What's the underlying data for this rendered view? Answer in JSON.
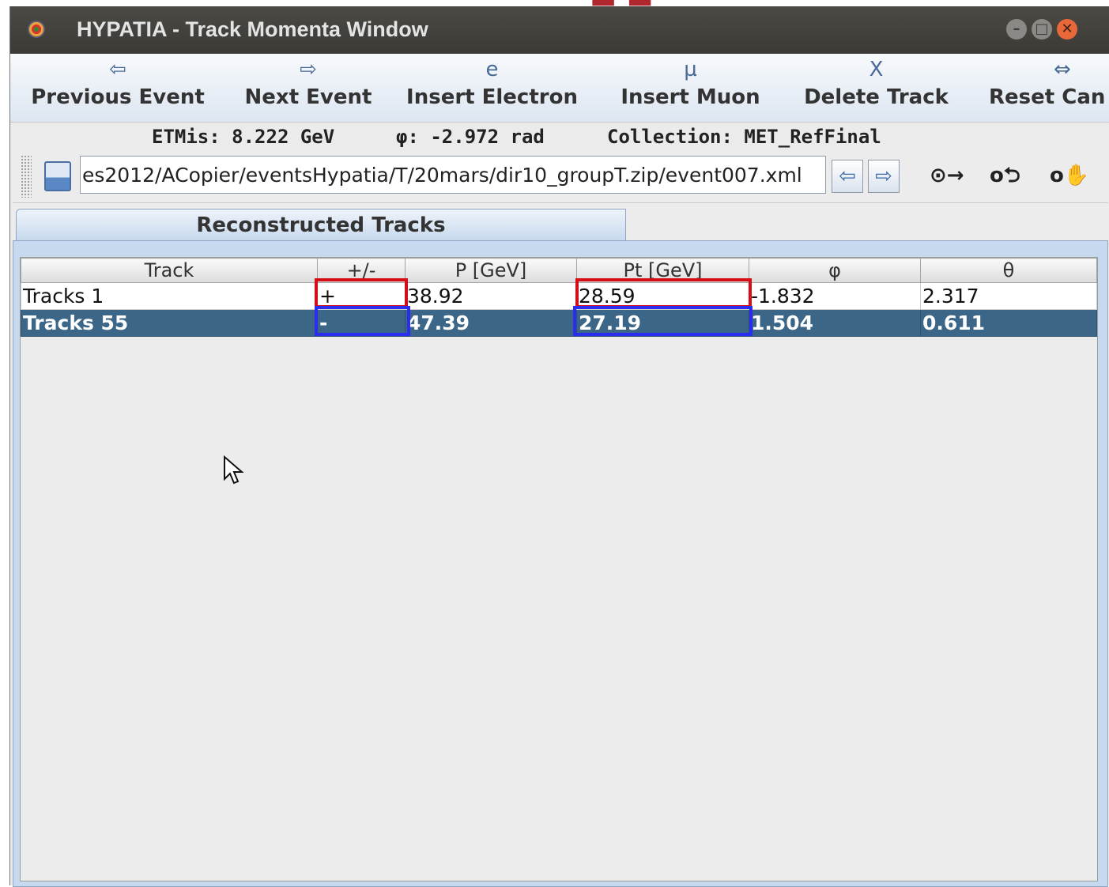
{
  "window": {
    "title": "HYPATIA - Track Momenta Window"
  },
  "toolbar": {
    "buttons": [
      {
        "label": "Previous Event",
        "icon": "⇦"
      },
      {
        "label": "Next Event",
        "icon": "⇨"
      },
      {
        "label": "Insert Electron",
        "icon": "e"
      },
      {
        "label": "Insert Muon",
        "icon": "µ"
      },
      {
        "label": "Delete Track",
        "icon": "X"
      },
      {
        "label": "Reset Can",
        "icon": "⇔"
      }
    ]
  },
  "info": {
    "etmis": "ETMis: 8.222 GeV",
    "phi": "φ: -2.972 rad",
    "collection": "Collection: MET_RefFinal"
  },
  "path": {
    "value": "es2012/ACopier/eventsHypatia/T/20mars/dir10_groupT.zip/event007.xml"
  },
  "tab": {
    "label": "Reconstructed Tracks"
  },
  "table": {
    "headers": [
      "Track",
      "+/-",
      "P [GeV]",
      "Pt [GeV]",
      "φ",
      "θ"
    ],
    "rows": [
      [
        "Tracks 1",
        "+",
        "38.92",
        "28.59",
        "-1.832",
        "2.317"
      ],
      [
        "Tracks 55",
        "-",
        "47.39",
        "27.19",
        "1.504",
        "0.611"
      ]
    ]
  },
  "colors": {
    "selected_row": "#3b6688",
    "highlight_red": "#d40e14",
    "highlight_blue": "#2a2cf0"
  }
}
